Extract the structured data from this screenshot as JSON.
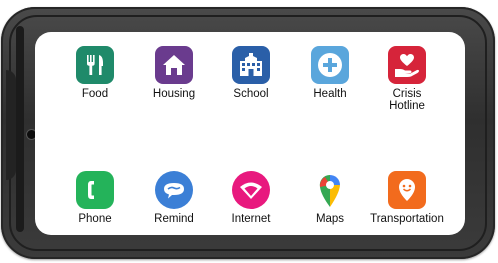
{
  "apps": [
    {
      "label": "Food",
      "icon": "utensils-icon",
      "color": "#1f8a6a"
    },
    {
      "label": "Housing",
      "icon": "house-icon",
      "color": "#6a3b8e"
    },
    {
      "label": "School",
      "icon": "school-icon",
      "color": "#2a5fa8"
    },
    {
      "label": "Health",
      "icon": "health-plus-icon",
      "color": "#5aa6dc"
    },
    {
      "label": "Crisis",
      "label2": "Hotline",
      "icon": "heart-hand-icon",
      "color": "#d6243a"
    },
    {
      "label": "Phone",
      "icon": "phone-icon",
      "color": "#24b35a"
    },
    {
      "label": "Remind",
      "icon": "chat-bubble-icon",
      "color": "#3b7fd6"
    },
    {
      "label": "Internet",
      "icon": "wifi-icon",
      "color": "#e8197e"
    },
    {
      "label": "Maps",
      "icon": "map-pin-icon",
      "color": "#ea4335"
    },
    {
      "label": "Transportation",
      "icon": "rideshare-smile-icon",
      "color": "#f26b1d"
    }
  ]
}
